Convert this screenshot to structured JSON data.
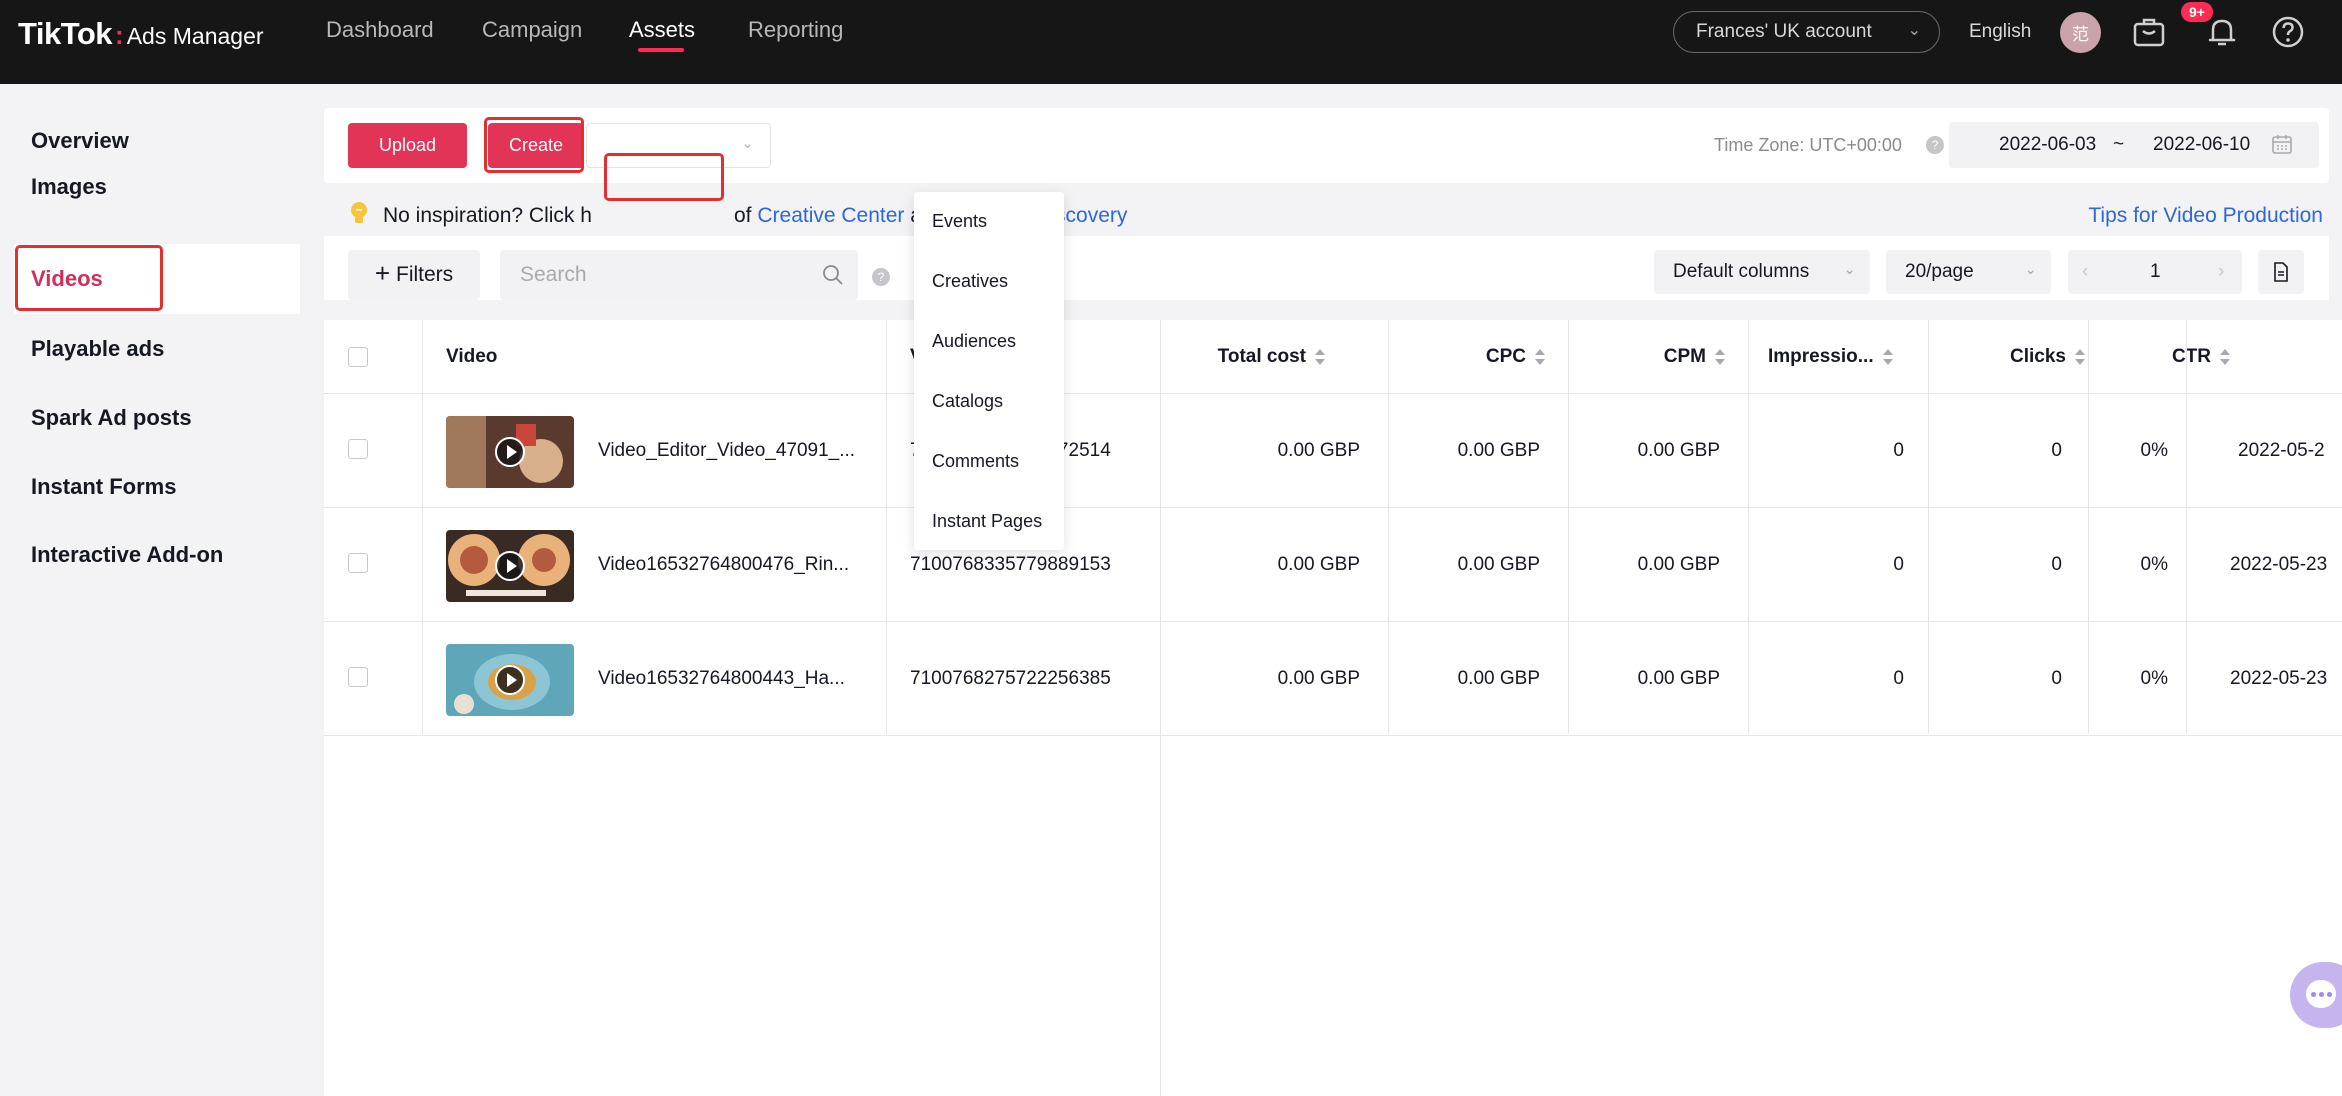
{
  "topnav": {
    "logo_brand": "TikTok",
    "logo_colon": ":",
    "logo_sub": "Ads Manager",
    "items": [
      {
        "label": "Dashboard"
      },
      {
        "label": "Campaign"
      },
      {
        "label": "Assets"
      },
      {
        "label": "Reporting"
      }
    ],
    "account": "Frances' UK account",
    "language": "English",
    "avatar_text": "范",
    "notification_badge": "9+"
  },
  "sidebar": {
    "items": [
      {
        "label": "Overview"
      },
      {
        "label": "Images"
      },
      {
        "label": "Videos"
      },
      {
        "label": "Playable ads"
      },
      {
        "label": "Spark Ad posts"
      },
      {
        "label": "Instant Forms"
      },
      {
        "label": "Interactive Add-on"
      }
    ]
  },
  "toolbar": {
    "upload_label": "Upload",
    "create_label": "Create",
    "timezone": "Time Zone: UTC+00:00",
    "date_start": "2022-06-03",
    "date_sep": "~",
    "date_end": "2022-06-10"
  },
  "tip": {
    "text_before": "No inspiration? Click h",
    "text_of": "of",
    "creative_center": "Creative Center",
    "and": "and",
    "creative_discovery": "Creative Discovery",
    "tips_link": "Tips for Video Production"
  },
  "filterbar": {
    "filters_label": "Filters",
    "search_placeholder": "Search",
    "columns_label": "Default columns",
    "page_size": "20/page",
    "page_number": "1"
  },
  "dropdown": {
    "items": [
      {
        "label": "Events"
      },
      {
        "label": "Creatives"
      },
      {
        "label": "Audiences"
      },
      {
        "label": "Catalogs"
      },
      {
        "label": "Comments"
      },
      {
        "label": "Instant Pages"
      }
    ]
  },
  "table": {
    "headers": {
      "video": "Video",
      "material_id": "Video Material ID",
      "total_cost": "Total cost",
      "cpc": "CPC",
      "cpm": "CPM",
      "impressions": "Impressio...",
      "clicks": "Clicks",
      "ctr": "CTR"
    },
    "rows": [
      {
        "name": "Video_Editor_Video_47091_...",
        "material_id": "7101636195105472514",
        "total_cost": "0.00 GBP",
        "cpc": "0.00 GBP",
        "cpm": "0.00 GBP",
        "impressions": "0",
        "clicks": "0",
        "ctr": "0%",
        "date": "2022-05-2",
        "thumb_colors": [
          "#5a3a2e",
          "#a0785c",
          "#d8b08c"
        ]
      },
      {
        "name": "Video16532764800476_Rin...",
        "material_id": "7100768335779889153",
        "total_cost": "0.00 GBP",
        "cpc": "0.00 GBP",
        "cpm": "0.00 GBP",
        "impressions": "0",
        "clicks": "0",
        "ctr": "0%",
        "date": "2022-05-23",
        "thumb_colors": [
          "#3a2a24",
          "#b55a3c",
          "#e8b27a"
        ]
      },
      {
        "name": "Video16532764800443_Ha...",
        "material_id": "7100768275722256385",
        "total_cost": "0.00 GBP",
        "cpc": "0.00 GBP",
        "cpm": "0.00 GBP",
        "impressions": "0",
        "clicks": "0",
        "ctr": "0%",
        "date": "2022-05-23",
        "thumb_colors": [
          "#5fa6b8",
          "#d9a24a",
          "#8cc6d4"
        ]
      }
    ]
  },
  "colors": {
    "accent": "#fe2c55",
    "highlight_box": "#e0302f",
    "link": "#2d67d8"
  }
}
